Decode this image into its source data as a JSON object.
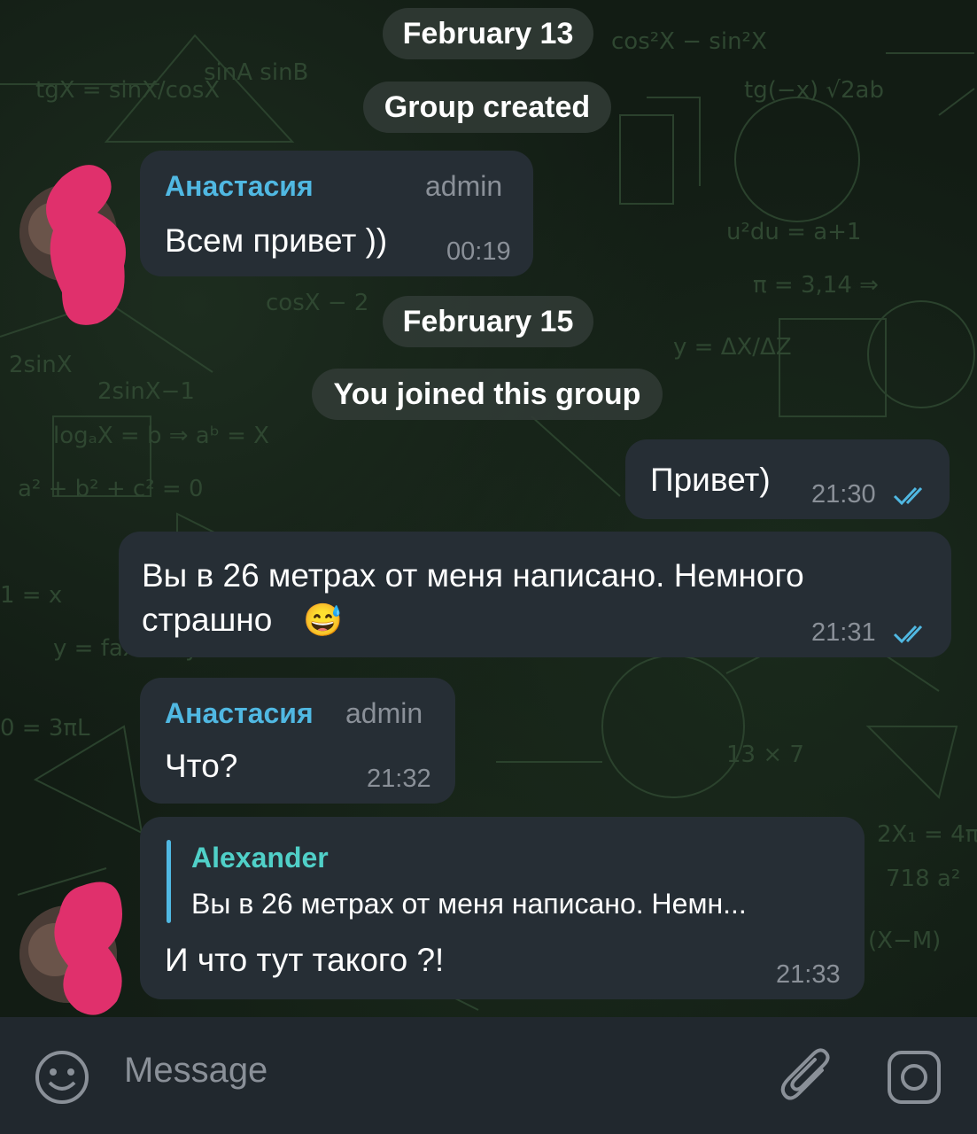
{
  "chat": {
    "date_1": "February 13",
    "service_1": "Group created",
    "date_2": "February 15",
    "service_2": "You joined this group",
    "messages": [
      {
        "sender": "Анастасия",
        "role": "admin",
        "text": "Всем привет ))",
        "time": "00:19"
      },
      {
        "text": "Привет)",
        "time": "21:30",
        "status": "read"
      },
      {
        "text_line1": "Вы в 26 метрах от меня написано. Немного",
        "text_line2": "страшно",
        "emoji": "😅",
        "time": "21:31",
        "status": "read"
      },
      {
        "sender": "Анастасия",
        "role": "admin",
        "text": "Что?",
        "time": "21:32"
      },
      {
        "reply_to_name": "Alexander",
        "reply_to_text": "Вы в 26 метрах от меня написано. Немн...",
        "text": "И что тут такого ?!",
        "time": "21:33"
      }
    ]
  },
  "composer": {
    "placeholder": "Message",
    "emoji_icon": "smile-icon",
    "attach_icon": "paperclip-icon",
    "camera_icon": "camera-icon"
  },
  "colors": {
    "accent": "#50b8e2",
    "bubble": "#262e35",
    "background": "#121c14"
  }
}
